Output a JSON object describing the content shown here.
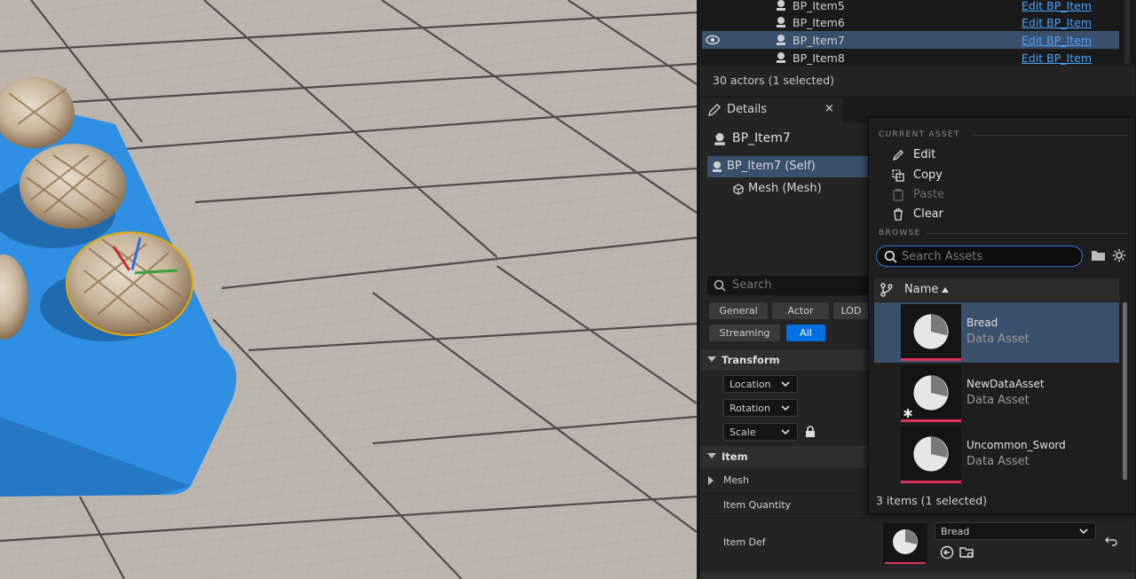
{
  "outliner": {
    "rows": [
      {
        "name": "BP_Item5",
        "link": "Edit BP_Item",
        "selected": false
      },
      {
        "name": "BP_Item6",
        "link": "Edit BP_Item",
        "selected": false
      },
      {
        "name": "BP_Item7",
        "link": "Edit BP_Item",
        "selected": true
      },
      {
        "name": "BP_Item8",
        "link": "Edit BP_Item",
        "selected": false
      }
    ],
    "status": "30 actors (1 selected)"
  },
  "details": {
    "tab_label": "Details",
    "close_glyph": "×",
    "actor_name": "BP_Item7",
    "components": [
      {
        "label": "BP_Item7 (Self)",
        "selected": true
      },
      {
        "label": "Mesh (Mesh)",
        "selected": false
      }
    ],
    "search_placeholder": "Search",
    "filter_chips": [
      {
        "label": "General",
        "active": false
      },
      {
        "label": "Actor",
        "active": false
      },
      {
        "label": "LOD",
        "active": false
      },
      {
        "label": "Streaming",
        "active": false
      },
      {
        "label": "All",
        "active": true
      }
    ],
    "transform_header": "Transform",
    "location_label": "Location",
    "rotation_label": "Rotation",
    "scale_label": "Scale",
    "item_header": "Item",
    "mesh_label": "Mesh",
    "item_quantity_label": "Item Quantity",
    "item_def_label": "Item Def",
    "item_def_value": "Bread"
  },
  "picker": {
    "current_asset_header": "CURRENT ASSET",
    "menu": [
      {
        "label": "Edit",
        "icon": "pencil-icon",
        "enabled": true
      },
      {
        "label": "Copy",
        "icon": "copy-icon",
        "enabled": true
      },
      {
        "label": "Paste",
        "icon": "paste-icon",
        "enabled": false
      },
      {
        "label": "Clear",
        "icon": "trash-icon",
        "enabled": true
      }
    ],
    "browse_header": "BROWSE",
    "search_placeholder": "Search Assets",
    "column_name": "Name",
    "assets": [
      {
        "name": "Bread",
        "type": "Data Asset",
        "selected": true
      },
      {
        "name": "NewDataAsset",
        "type": "Data Asset",
        "selected": false
      },
      {
        "name": "Uncommon_Sword",
        "type": "Data Asset",
        "selected": false
      }
    ],
    "footer": "3 items (1 selected)"
  },
  "colors": {
    "selection": "#3a4f6c",
    "accent_blue": "#0070e0",
    "asset_color_bar": "#e0335a",
    "link": "#4aa3ff"
  }
}
